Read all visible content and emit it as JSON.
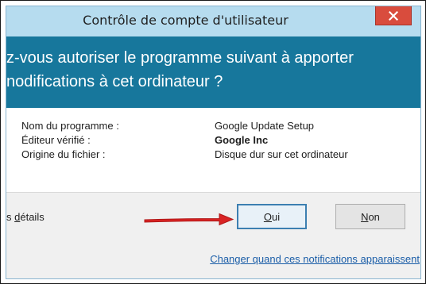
{
  "window": {
    "title": "Contrôle de compte d'utilisateur"
  },
  "header": {
    "question_line1": "z-vous autoriser le programme suivant à apporter",
    "question_line2": "nodifications à cet ordinateur ?"
  },
  "info": {
    "rows": [
      {
        "label": "Nom du programme :",
        "value": "Google Update Setup"
      },
      {
        "label": "Éditeur vérifié :",
        "value": "Google Inc"
      },
      {
        "label": "Origine du fichier :",
        "value": "Disque dur sur cet ordinateur"
      }
    ]
  },
  "footer": {
    "details_prefix": "s ",
    "details_underlined": "d",
    "details_suffix": "étails",
    "yes_underlined": "O",
    "yes_rest": "ui",
    "no_underlined": "N",
    "no_rest": "on",
    "notifications_link": "Changer quand ces notifications apparaissent"
  },
  "colors": {
    "header_band": "#17779c",
    "title_bar": "#b6dcef",
    "close_button": "#d94c3d",
    "annotation_arrow": "#d92323",
    "link": "#1b5ea8"
  },
  "icons": {
    "close": "close-x-icon",
    "annotation": "red-arrow-annotation"
  }
}
